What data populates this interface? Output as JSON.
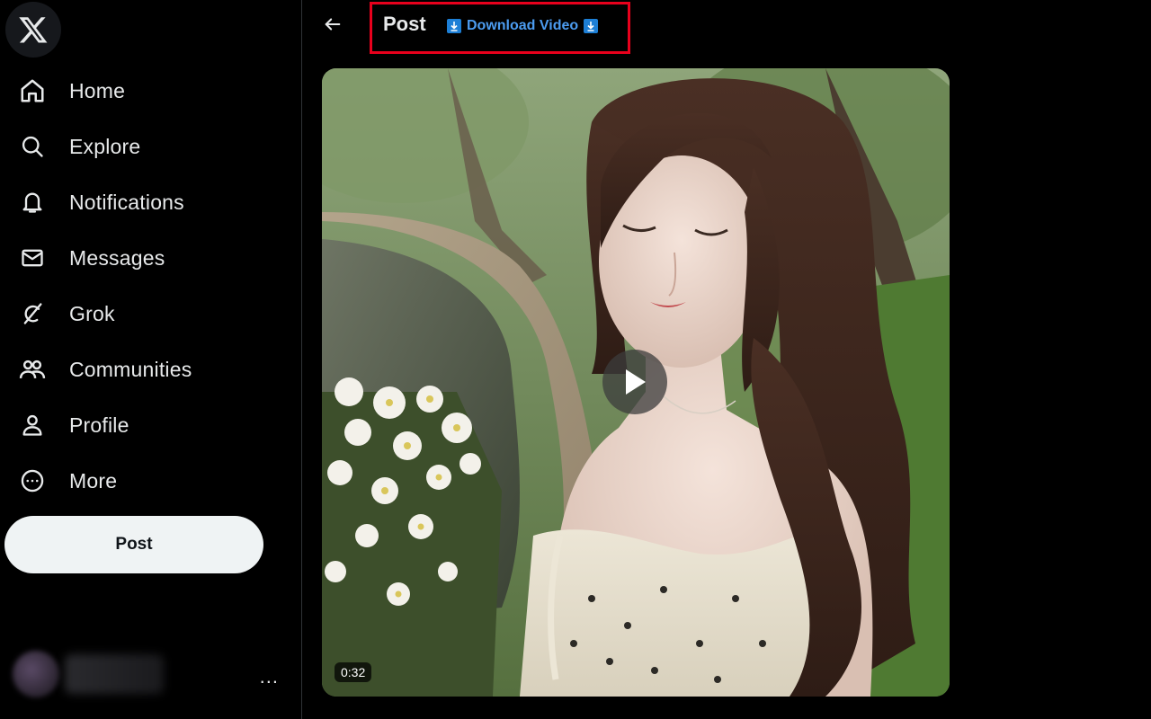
{
  "sidebar": {
    "nav": [
      {
        "label": "Home",
        "icon": "home-icon"
      },
      {
        "label": "Explore",
        "icon": "search-icon"
      },
      {
        "label": "Notifications",
        "icon": "bell-icon"
      },
      {
        "label": "Messages",
        "icon": "envelope-icon"
      },
      {
        "label": "Grok",
        "icon": "grok-icon"
      },
      {
        "label": "Communities",
        "icon": "people-icon"
      },
      {
        "label": "Profile",
        "icon": "person-icon"
      },
      {
        "label": "More",
        "icon": "more-circle-icon"
      }
    ],
    "post_button": "Post",
    "account_more": "..."
  },
  "header": {
    "title": "Post",
    "download_label": "Download Video",
    "highlight_color": "#e8001c",
    "link_color": "#4c9cf0"
  },
  "media": {
    "duration": "0:32"
  },
  "colors": {
    "background": "#000000",
    "text": "#e7e9ea",
    "border": "#2f3336",
    "post_button_bg": "#eff3f4"
  }
}
